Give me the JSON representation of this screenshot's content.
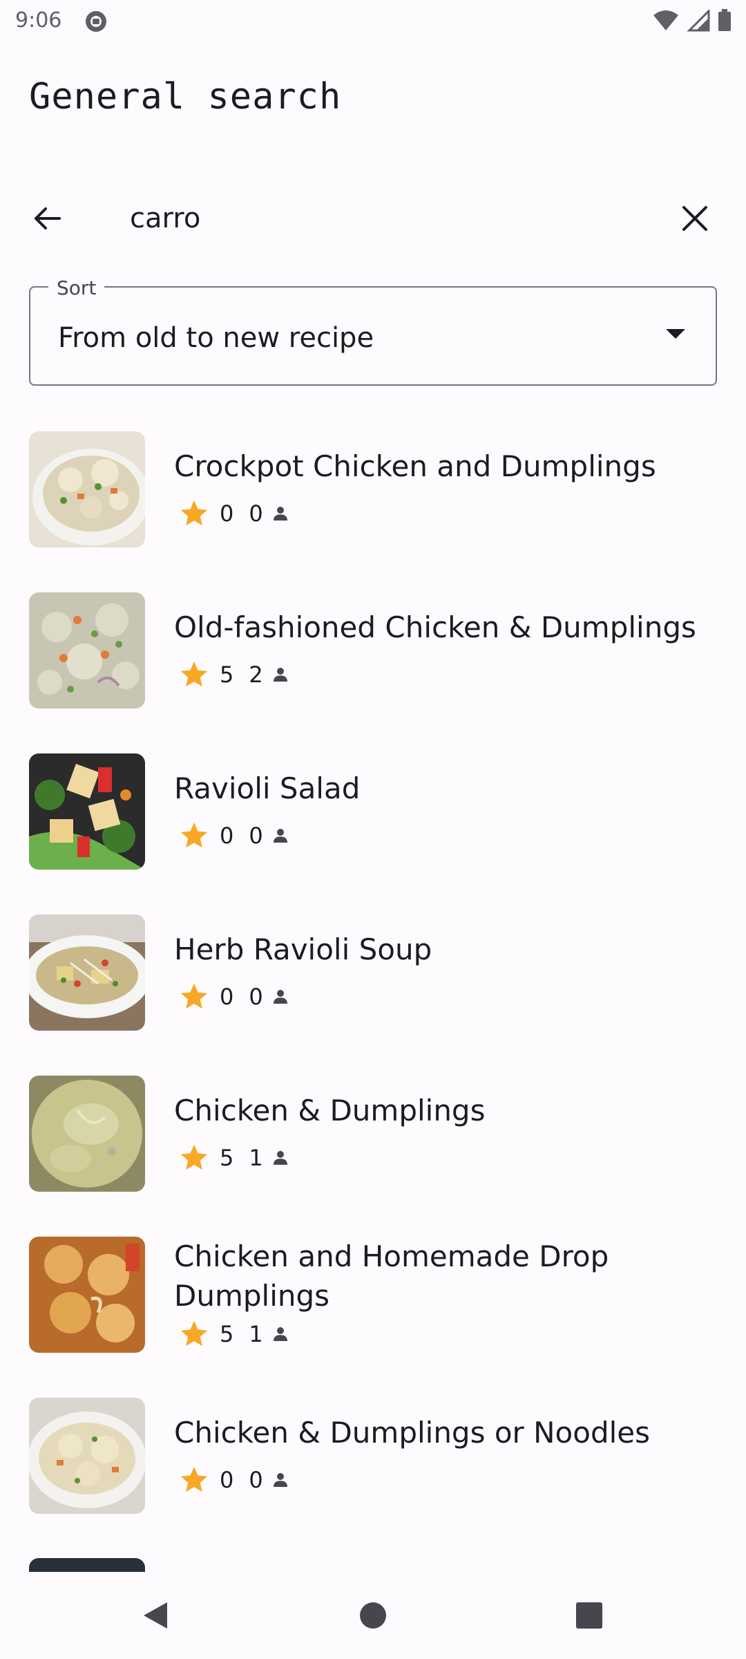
{
  "status_bar": {
    "time": "9:06",
    "icons": [
      "notification-icon",
      "wifi-icon",
      "signal-icon",
      "battery-icon"
    ]
  },
  "header": {
    "title": "General search"
  },
  "search": {
    "value": "carro",
    "back_icon": "arrow-left-icon",
    "clear_icon": "close-icon"
  },
  "sort": {
    "label": "Sort",
    "value": "From old to new recipe",
    "dropdown_icon": "dropdown-arrow-icon"
  },
  "colors": {
    "star": "#f9a825",
    "text": "#1c1b1f",
    "outline": "#79747e"
  },
  "recipes": [
    {
      "title": "Crockpot Chicken and Dumplings",
      "rating": "0",
      "reviews": "0"
    },
    {
      "title": "Old-fashioned Chicken & Dumplings",
      "rating": "5",
      "reviews": "2"
    },
    {
      "title": "Ravioli Salad",
      "rating": "0",
      "reviews": "0"
    },
    {
      "title": "Herb Ravioli Soup",
      "rating": "0",
      "reviews": "0"
    },
    {
      "title": "Chicken & Dumplings",
      "rating": "5",
      "reviews": "1"
    },
    {
      "title": "Chicken and Homemade Drop Dumplings",
      "rating": "5",
      "reviews": "1"
    },
    {
      "title": "Chicken & Dumplings or Noodles",
      "rating": "0",
      "reviews": "0"
    }
  ],
  "nav": {
    "icons": [
      "back-triangle-icon",
      "home-circle-icon",
      "recents-square-icon"
    ]
  }
}
